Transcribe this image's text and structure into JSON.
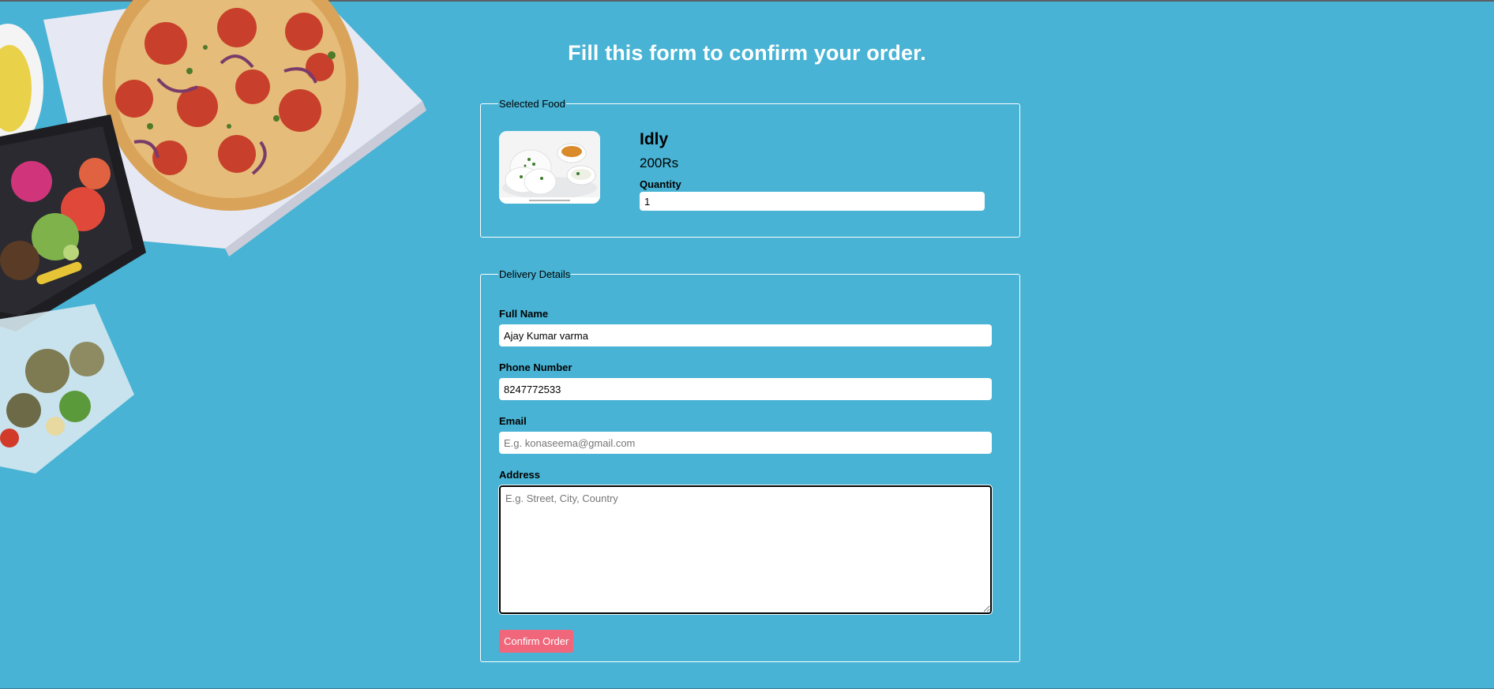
{
  "page": {
    "title": "Fill this form to confirm your order."
  },
  "selected_food": {
    "legend": "Selected Food",
    "name": "Idly",
    "price": "200Rs",
    "quantity_label": "Quantity",
    "quantity_value": "1"
  },
  "delivery": {
    "legend": "Delivery Details",
    "full_name": {
      "label": "Full Name",
      "value": "Ajay Kumar varma"
    },
    "phone": {
      "label": "Phone Number",
      "value": "8247772533"
    },
    "email": {
      "label": "Email",
      "value": "",
      "placeholder": "E.g. konaseema@gmail.com"
    },
    "address": {
      "label": "Address",
      "value": "",
      "placeholder": "E.g. Street, City, Country"
    },
    "confirm_label": "Confirm Order"
  },
  "colors": {
    "background": "#48b3d4",
    "button": "#f0677c",
    "border": "#ffffff"
  }
}
